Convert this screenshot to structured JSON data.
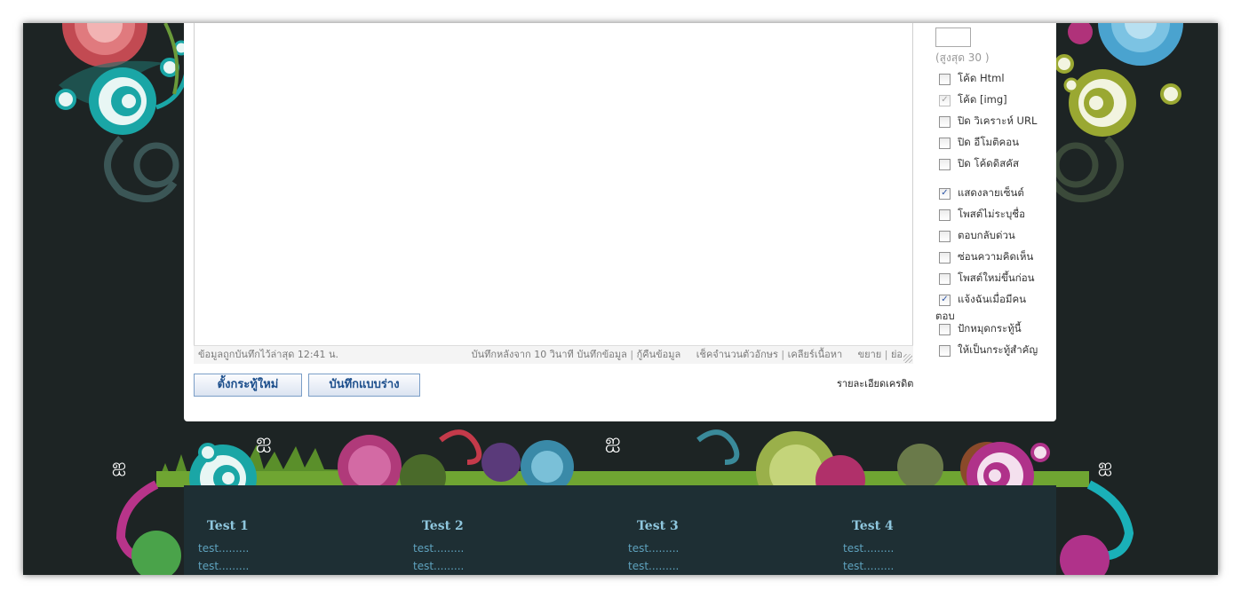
{
  "editor": {
    "status_left": "ข้อมูลถูกบันทึกไว้ล่าสุด 12:41 น.",
    "status_autosave": "บันทึกหลังจาก 10 วินาที",
    "status_save": "บันทึกข้อมูล",
    "status_restore": "กู้คืนข้อมูล",
    "status_count": "เช็คจำนวนตัวอักษร",
    "status_clear": "เคลียร์เนื้อหา",
    "status_expand": "ขยาย",
    "status_shrink": "ย่อ",
    "separator": "|"
  },
  "buttons": {
    "new_thread": "ตั้งกระทู้ใหม่",
    "save_draft": "บันทึกแบบร่าง"
  },
  "credit_link": "รายละเอียดเครดิต",
  "sidebar": {
    "number_value": "",
    "max_text": "(สูงสุด 30 )",
    "options": [
      {
        "label": "โค้ด Html",
        "checked": false,
        "disabled": false
      },
      {
        "label": "โค้ด [img]",
        "checked": true,
        "disabled": true
      },
      {
        "label": "ปิด วิเคราะห์ URL",
        "checked": false,
        "disabled": false
      },
      {
        "label": "ปิด อีโมติคอน",
        "checked": false,
        "disabled": false
      },
      {
        "label": "ปิด โค้ดดิสคัส",
        "checked": false,
        "disabled": false
      },
      {
        "label": "แสดงลายเซ็นต์",
        "checked": true,
        "disabled": false
      },
      {
        "label": "โพสต์ไม่ระบุชื่อ",
        "checked": false,
        "disabled": false
      },
      {
        "label": "ตอบกลับด่วน",
        "checked": false,
        "disabled": false
      },
      {
        "label": "ซ่อนความคิดเห็น",
        "checked": false,
        "disabled": false
      },
      {
        "label": "โพสต์ใหม่ขึ้นก่อน",
        "checked": false,
        "disabled": false
      },
      {
        "label": "แจ้งฉันเมื่อมีคน",
        "checked": true,
        "disabled": false
      },
      {
        "label": "ปักหมุดกระทู้นี้",
        "checked": false,
        "disabled": false
      },
      {
        "label": "ให้เป็นกระทู้สำคัญ",
        "checked": false,
        "disabled": false
      }
    ],
    "wrap_text": "ตอบ",
    "check_mark": "✓"
  },
  "footer": {
    "columns": [
      {
        "title": "Test 1",
        "items": [
          "test.........",
          "test........."
        ]
      },
      {
        "title": "Test 2",
        "items": [
          "test.........",
          "test........."
        ]
      },
      {
        "title": "Test 3",
        "items": [
          "test.........",
          "test........."
        ]
      },
      {
        "title": "Test 4",
        "items": [
          "test.........",
          "test........."
        ]
      }
    ]
  },
  "colors": {
    "background": "#1d2424",
    "footer": "#1e2f34",
    "footer_title": "#8fc7de",
    "footer_link": "#5fa3bf",
    "button_text": "#1d4f8c"
  }
}
